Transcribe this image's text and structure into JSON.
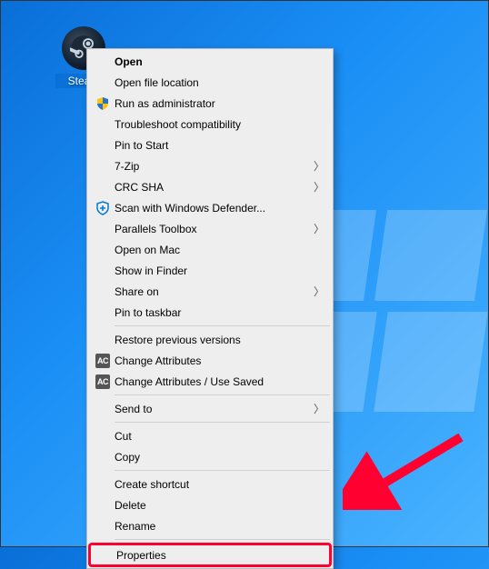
{
  "desktop": {
    "icon_label": "Steam"
  },
  "menu": {
    "open": "Open",
    "open_location": "Open file location",
    "run_admin": "Run as administrator",
    "troubleshoot": "Troubleshoot compatibility",
    "pin_start": "Pin to Start",
    "sevenzip": "7-Zip",
    "crc_sha": "CRC SHA",
    "defender": "Scan with Windows Defender...",
    "parallels": "Parallels Toolbox",
    "open_mac": "Open on Mac",
    "show_finder": "Show in Finder",
    "share_on": "Share on",
    "pin_taskbar": "Pin to taskbar",
    "restore_versions": "Restore previous versions",
    "change_attr": "Change Attributes",
    "change_attr_saved": "Change Attributes / Use Saved",
    "send_to": "Send to",
    "cut": "Cut",
    "copy": "Copy",
    "create_shortcut": "Create shortcut",
    "delete": "Delete",
    "rename": "Rename",
    "properties": "Properties"
  },
  "badges": {
    "ac": "AC"
  },
  "annotation": {
    "color": "#ff0030"
  }
}
